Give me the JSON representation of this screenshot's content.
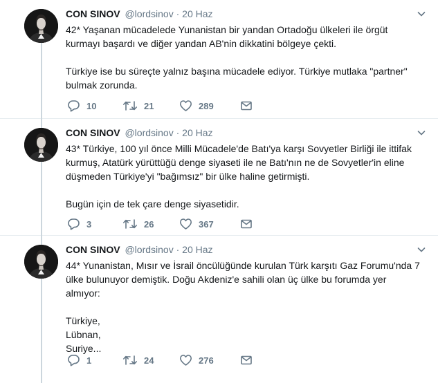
{
  "tweets": [
    {
      "name": "CON SINOV",
      "handle": "@lordsinov",
      "separator": "·",
      "date": "20 Haz",
      "paragraphs": [
        "42* Yaşanan mücadelede Yunanistan bir yandan Ortadoğu ülkeleri ile örgüt kurmayı başardı ve diğer yandan AB'nin dikkatini bölgeye çekti.",
        "Türkiye ise bu süreçte yalnız başına mücadele ediyor. Türkiye mutlaka \"partner\" bulmak zorunda."
      ],
      "replies": "10",
      "retweets": "21",
      "likes": "289"
    },
    {
      "name": "CON SINOV",
      "handle": "@lordsinov",
      "separator": "·",
      "date": "20 Haz",
      "paragraphs": [
        "43* Türkiye, 100 yıl önce Milli Mücadele'de Batı'ya karşı Sovyetler Birliği ile ittifak kurmuş, Atatürk yürüttüğü denge siyaseti ile ne Batı'nın ne de Sovyetler'in eline düşmeden Türkiye'yi \"bağımsız\" bir ülke haline getirmişti.",
        "Bugün için de tek çare denge siyasetidir."
      ],
      "replies": "3",
      "retweets": "26",
      "likes": "367"
    },
    {
      "name": "CON SINOV",
      "handle": "@lordsinov",
      "separator": "·",
      "date": "20 Haz",
      "paragraphs": [
        "44* Yunanistan, Mısır ve İsrail öncülüğünde kurulan Türk karşıtı Gaz Forumu'nda 7 ülke bulunuyor demiştik. Doğu Akdeniz'e sahili olan üç ülke bu forumda yer almıyor:",
        "Türkiye,",
        "Lübnan,",
        "Suriye..."
      ],
      "replies": "1",
      "retweets": "24",
      "likes": "276"
    }
  ],
  "icons": {
    "reply": "reply-icon",
    "retweet": "retweet-icon",
    "like": "heart-icon",
    "message": "envelope-icon",
    "more": "chevron-down-icon"
  },
  "colors": {
    "text": "#14171a",
    "secondary": "#657786",
    "thread_line": "#ccd6dd",
    "divider": "#e6ecf0"
  }
}
